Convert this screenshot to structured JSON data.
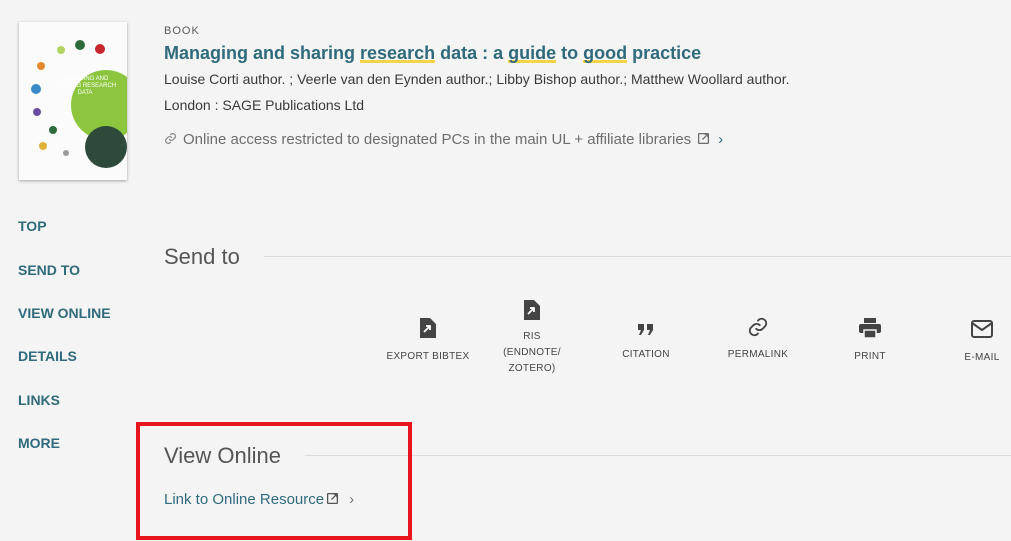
{
  "record": {
    "format": "BOOK",
    "title_parts": [
      "Managing and sharing ",
      "research",
      " data : a ",
      "guide",
      " to ",
      "good",
      " practice"
    ],
    "authors": "Louise Corti author. ; Veerle van den Eynden author.; Libby Bishop author.; Matthew Woollard author.",
    "publisher": "London : SAGE Publications Ltd",
    "access_text": "Online access restricted to designated PCs in the main UL + affiliate libraries",
    "access_icon": "link-icon",
    "external_icon": "external-link-icon",
    "chevron": "›"
  },
  "cover": {
    "title": "Managing and Sharing Research Data",
    "accent_color": "#8cc63f"
  },
  "nav": {
    "items": [
      "TOP",
      "SEND TO",
      "VIEW ONLINE",
      "DETAILS",
      "LINKS",
      "MORE"
    ]
  },
  "send_to": {
    "heading": "Send to",
    "actions": [
      {
        "label": "EXPORT BIBTEX",
        "icon": "file-export-icon"
      },
      {
        "label": "RIS (ENDNOTE/ ZOTERO)",
        "icon": "file-export-icon"
      },
      {
        "label": "CITATION",
        "icon": "quote-icon"
      },
      {
        "label": "PERMALINK",
        "icon": "link-icon"
      },
      {
        "label": "PRINT",
        "icon": "printer-icon"
      },
      {
        "label": "E-MAIL",
        "icon": "envelope-icon"
      }
    ]
  },
  "view_online": {
    "heading": "View Online",
    "link_label": "Link to Online Resource"
  },
  "colors": {
    "link": "#2f6a7d",
    "highlight_underline": "#f5d547",
    "annotation_box": "#e8141b"
  }
}
